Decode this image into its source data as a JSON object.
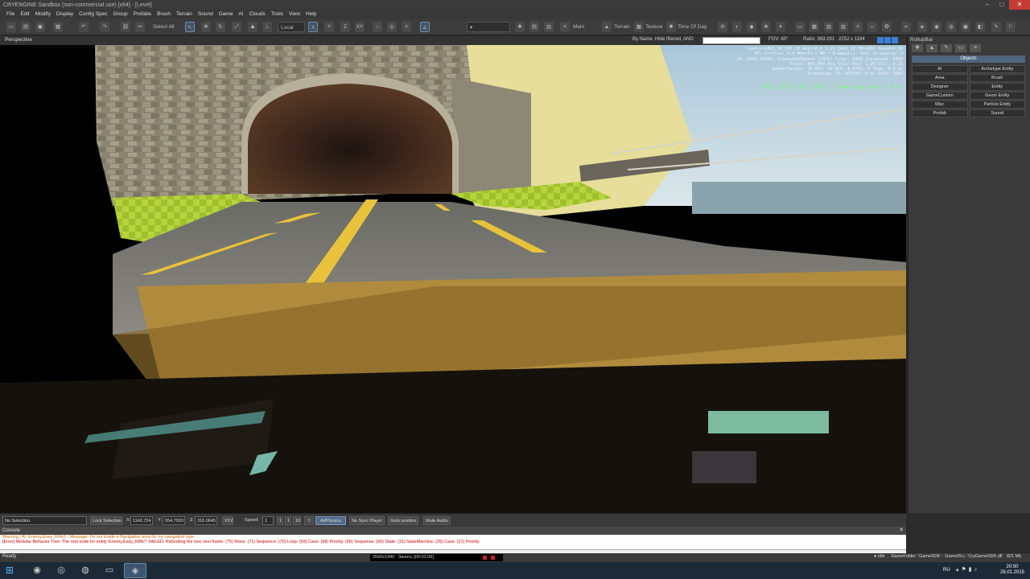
{
  "window": {
    "title": "CRYENGINE Sandbox (non-commercial use) [x64] - [Level]"
  },
  "menu": [
    "File",
    "Edit",
    "Modify",
    "Display",
    "Config Spec",
    "Group",
    "Prefabs",
    "Brush",
    "Terrain",
    "Sound",
    "Game",
    "AI",
    "Clouds",
    "Tools",
    "View",
    "Help"
  ],
  "toolbar": {
    "select_all": "Select All",
    "coord_system": "Local",
    "axis_x": "X",
    "axis_y": "Y",
    "axis_z": "Z",
    "axis_xy": "XY",
    "main_label": "Main",
    "terrain_label": "Terrain",
    "texture_label": "Texture",
    "time_of_day_label": "Time Of Day"
  },
  "viewport": {
    "name": "Perspective",
    "filter": "By Name, Hide filtered, AND",
    "fov_label": "FOV:",
    "fov_value": "60°",
    "ratio_label": "Ratio:",
    "ratio_value": "363:291",
    "resolution": "2252 x 1164",
    "fps": "FPS 119.6 (85..166), frame avg over 1.0 s"
  },
  "rollup": {
    "title": "RollupBar",
    "section": "Objects",
    "buttons": [
      "AI",
      "Archetype Entity",
      "Area",
      "Brush",
      "Designer",
      "Entity",
      "GameCustom",
      "Geom Entity",
      "Misc",
      "Particle Entity",
      "Prefab",
      "Sound"
    ]
  },
  "status_row": {
    "selection": "No Selection",
    "lock_selection": "Lock Selection",
    "x_label": "X:",
    "x_value": "1142.724",
    "y_label": "Y:",
    "y_value": "554.7003",
    "z_label": "Z:",
    "z_value": "316.0645",
    "xyz_label": "XYZ",
    "speed_label": "Speed:",
    "speed_value": "1",
    "speed_opt_1": "1",
    "speed_opt_2": "1",
    "speed_opt_3": "10",
    "ai_physics": "AI/Physics",
    "no_sync_player": "No Sync Player",
    "goto_position": "Goto position",
    "mute_audio": "Mute Audio"
  },
  "console": {
    "title": "Console",
    "warning": "Warning [ AI: Enemy.Easy_Rifle5 - Message: I'm not inside a Navigation area for my navigation type.",
    "error": "[Error] Modular Behavior Tree: The root node for entity 'Enemy.Easy_Rifle7' FAILED. Rebooting the tree next frame. (75) Move. (71) Sequence. (70) Loop. (69) Case. (68) Priority. (66) Sequence. (60) State. (31) StateMachine. (29) Case. (21) Priority."
  },
  "status_bar": {
    "ready": "Ready",
    "recording_res": "2560x1440",
    "recording_time": "Запись [00:01:09]",
    "idle": "Idle",
    "game_folder": "GameFolder: 'GameSDK' - GameDLL: 'CryGameSDK.dll'",
    "memory": "821 Mb"
  },
  "taskbar": {
    "language": "RU",
    "time": "20:50",
    "date": "28.01.2015"
  },
  "colors": {
    "accent": "#3a7fd6",
    "fps_green": "#74ff74",
    "error_red": "#cc0000"
  }
}
